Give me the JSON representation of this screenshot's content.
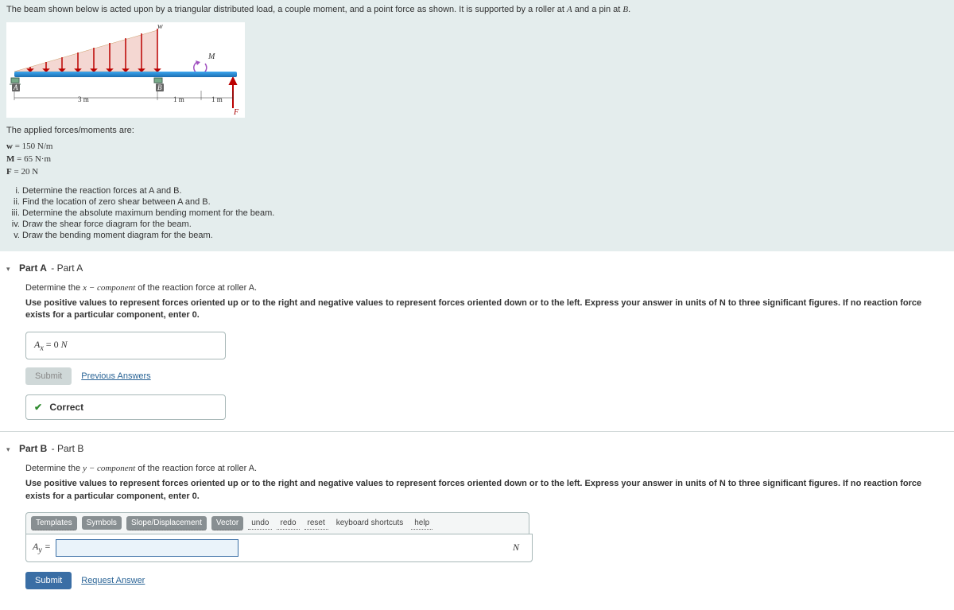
{
  "intro": "The beam shown below is acted upon by a triangular distributed load, a couple moment, and a point force as shown. It is supported by a roller at A and a pin at B.",
  "diagram": {
    "label_w": "w",
    "label_M": "M",
    "label_F": "F",
    "label_A": "A",
    "label_B": "B",
    "dim_AB": "3 m",
    "dim_BC": "1 m",
    "dim_CD": "1 m"
  },
  "forces_heading": "The applied forces/moments are:",
  "forces": {
    "w": {
      "label": "w",
      "eq": "= 150 N/m"
    },
    "M": {
      "label": "M",
      "eq": "= 65 N·m"
    },
    "F": {
      "label": "F",
      "eq": "= 20 N"
    }
  },
  "tasks": [
    "Determine the reaction forces at A and B.",
    "Find the location of zero shear between A and B.",
    "Determine the absolute maximum bending moment for the beam.",
    "Draw the shear force diagram for the beam.",
    "Draw the bending moment diagram for the beam."
  ],
  "partA": {
    "title_bold": "Part A",
    "title_rest": " - Part A",
    "instruction_pre": "Determine the ",
    "instruction_var": "x − component",
    "instruction_post": " of the reaction force at roller A.",
    "bold_instruction": "Use positive values to represent forces oriented up or to the right and negative values to represent forces oriented down or to the left. Express your answer in units of N to three significant figures. If no reaction force exists for a particular component, enter 0.",
    "answer_prefix": "A",
    "answer_sub": "x",
    "answer_eq": " = 0 ",
    "answer_unit": "N",
    "submit": "Submit",
    "previous": "Previous Answers",
    "status": "Correct"
  },
  "partB": {
    "title_bold": "Part B",
    "title_rest": " - Part B",
    "instruction_pre": "Determine the ",
    "instruction_var": "y − component",
    "instruction_post": " of the reaction force at roller A.",
    "bold_instruction": "Use positive values to represent forces oriented up or to the right and negative values to represent forces oriented down or to the left. Express your answer in units of N to three significant figures. If no reaction force exists for a particular component, enter 0.",
    "toolbar": {
      "templates": "Templates",
      "symbols": "Symbols",
      "slope": "Slope/Displacement",
      "vector": "Vector",
      "undo": "undo",
      "redo": "redo",
      "reset": "reset",
      "keyboard": "keyboard shortcuts",
      "help": "help"
    },
    "prefix": "A",
    "prefix_sub": "y",
    "eq": " = ",
    "unit": "N",
    "submit": "Submit",
    "request": "Request Answer"
  }
}
